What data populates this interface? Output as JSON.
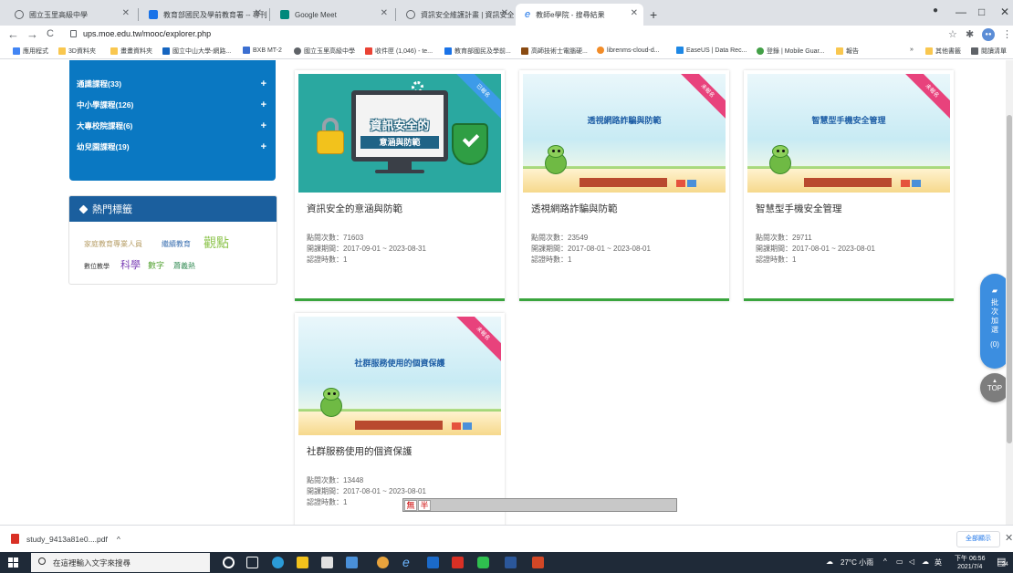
{
  "browser": {
    "tabs": [
      {
        "title": "國立玉里高級中學",
        "favicon_color": "#5f6368"
      },
      {
        "title": "教育部國民及學前教育署 -- 專刊",
        "favicon_color": "#1a73e8"
      },
      {
        "title": "Google Meet",
        "favicon_color": "#f4b400"
      },
      {
        "title": "資訊安全維護計畫 | 資訊安全文",
        "favicon_color": "#5f6368"
      },
      {
        "title": "教師e學院 - 搜尋結果",
        "favicon_color": "#1a73e8"
      }
    ],
    "active_tab_index": 4,
    "new_tab_label": "+",
    "window_controls": [
      "—",
      "□",
      "✕"
    ],
    "url": "ups.moe.edu.tw/mooc/explorer.php",
    "bookmarks": [
      {
        "label": "應用程式",
        "color": "#4285f4"
      },
      {
        "label": "3D資料夾",
        "color": "#f9c74f"
      },
      {
        "label": "畫畫資料夾",
        "color": "#f9c74f"
      },
      {
        "label": "國立中山大學-網路...",
        "color": "#1565c0"
      },
      {
        "label": "BXB MT-2",
        "color": "#3b6fd1"
      },
      {
        "label": "國立玉里高級中學",
        "color": "#5f6368"
      },
      {
        "label": "收件匣 (1,046) - te...",
        "color": "#ea4335"
      },
      {
        "label": "教育部國民及學前...",
        "color": "#1a73e8"
      },
      {
        "label": "高師技術士電腦硬...",
        "color": "#8a4b12"
      },
      {
        "label": "librenms-cloud-d...",
        "color": "#f28c28"
      },
      {
        "label": "EaseUS | Data Rec...",
        "color": "#1e88e5"
      },
      {
        "label": "登錄 | Mobile Guar...",
        "color": "#43a047"
      },
      {
        "label": "報告",
        "color": "#f9c74f"
      },
      {
        "label": "其他書籤",
        "color": "#f9c74f"
      },
      {
        "label": "閱讀清單",
        "color": "#5f6368"
      }
    ],
    "bookmarks_overflow": "»"
  },
  "sidebar": {
    "categories": [
      {
        "label": "通識課程(33)",
        "icon": "plus-icon"
      },
      {
        "label": "中小學課程(126)",
        "icon": "plus-icon"
      },
      {
        "label": "大專校院課程(6)",
        "icon": "plus-icon"
      },
      {
        "label": "幼兒園課程(19)",
        "icon": "plus-icon"
      }
    ],
    "hot_tags": {
      "title": "熱門標籤",
      "tags": [
        {
          "label": "家庭教育專業人員",
          "color": "#b8a06a"
        },
        {
          "label": "繼續教育",
          "color": "#3a6fb0"
        },
        {
          "label": "觀點",
          "color": "#8bc34a"
        },
        {
          "label": "數位教學",
          "color": "#333333"
        },
        {
          "label": "科學",
          "color": "#7b3fb5"
        },
        {
          "label": "數字",
          "color": "#5aa63a"
        },
        {
          "label": "蕭義熱",
          "color": "#3a8f5a"
        }
      ]
    }
  },
  "courses": [
    {
      "title": "資訊安全的意涵與防範",
      "thumb_style": "security",
      "thumb_title": "資訊安全的",
      "thumb_subtitle": "意涵與防範",
      "ribbon": "已報名",
      "ribbon_color": "#3d9be9",
      "views_label": "點閱次數：71603",
      "period_label": "開課期間：2017-09-01 ~ 2023-08-31",
      "hours_label": "認證時數：1"
    },
    {
      "title": "透視網路詐騙與防範",
      "thumb_style": "landscape",
      "thumb_title": "透視網路詐騙與防範",
      "ribbon": "未報名",
      "ribbon_color": "#e8427c",
      "views_label": "點閱次數：23549",
      "period_label": "開課期間：2017-08-01 ~ 2023-08-01",
      "hours_label": "認證時數：1"
    },
    {
      "title": "智慧型手機安全管理",
      "thumb_style": "landscape",
      "thumb_title": "智慧型手機安全管理",
      "ribbon": "未報名",
      "ribbon_color": "#e8427c",
      "views_label": "點閱次數：29711",
      "period_label": "開課期間：2017-08-01 ~ 2023-08-01",
      "hours_label": "認證時數：1"
    },
    {
      "title": "社群服務使用的個資保護",
      "thumb_style": "landscape",
      "thumb_title": "社群服務使用的個資保護",
      "ribbon": "未報名",
      "ribbon_color": "#e8427c",
      "views_label": "點閱次數：13448",
      "period_label": "開課期間：2017-08-01 ~ 2023-08-01",
      "hours_label": "認證時數：1"
    }
  ],
  "floating": {
    "batch_add": [
      "批",
      "次",
      "加",
      "選"
    ],
    "batch_count": "(0)",
    "top_label": "TOP"
  },
  "ime": {
    "mode1": "無",
    "mode2": "半"
  },
  "download_shelf": {
    "filename": "study_9413a81e0....pdf",
    "chevron": "^",
    "show_all": "全部顯示",
    "close": "✕"
  },
  "taskbar": {
    "search_placeholder": "在這裡輸入文字來搜尋",
    "weather": "27°C 小雨",
    "ime": "英",
    "time": "下午 06:56",
    "date": "2021/7/4",
    "notification_count": "24"
  }
}
